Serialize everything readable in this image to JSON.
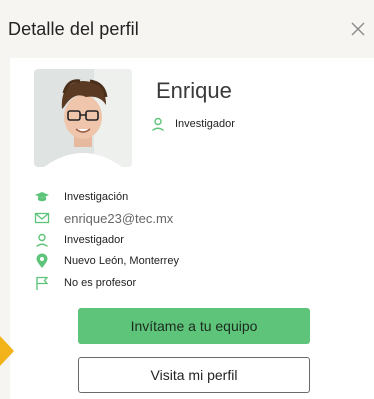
{
  "panel": {
    "title": "Detalle del perfil",
    "close_icon": "close-icon"
  },
  "profile": {
    "name": "Enrique",
    "role": "Investigador"
  },
  "info": [
    {
      "icon": "graduation-cap-icon",
      "text": "Investigación"
    },
    {
      "icon": "mail-icon",
      "text": "enrique23@tec.mx"
    },
    {
      "icon": "user-icon",
      "text": "Investigador"
    },
    {
      "icon": "location-pin-icon",
      "text": "Nuevo León, Monterrey"
    },
    {
      "icon": "flag-icon",
      "text": "No es profesor"
    }
  ],
  "actions": {
    "invite_label": "Invítame a tu equipo",
    "visit_label": "Visita mi perfil"
  },
  "colors": {
    "accent": "#5ec47a",
    "marker": "#f2b21a"
  }
}
